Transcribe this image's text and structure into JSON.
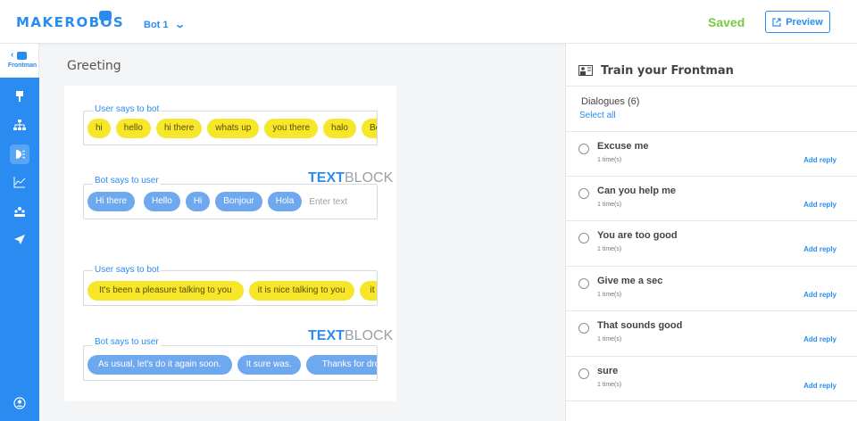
{
  "header": {
    "logo": "MAKEROBOS",
    "bot_name": "Bot 1",
    "saved": "Saved",
    "preview": "Preview"
  },
  "sidebar": {
    "frontman_label": "Frontman",
    "items": [
      {
        "name": "brush-icon"
      },
      {
        "name": "sitemap-icon"
      },
      {
        "name": "intent-icon",
        "active": true
      },
      {
        "name": "analytics-icon"
      },
      {
        "name": "users-icon"
      },
      {
        "name": "send-icon"
      },
      {
        "name": "account-icon"
      }
    ]
  },
  "main": {
    "title": "Greeting",
    "blocks": [
      {
        "user_label": "User says to bot",
        "user_says": [
          "hi",
          "hello",
          "hi there",
          "whats up",
          "you there",
          "halo",
          "Bonjour"
        ],
        "bot_label": "Bot says to user",
        "tab_text": "TEXT",
        "tab_block": "BLOCK",
        "bot_says": [
          "Hi there",
          "Hello",
          "Hi",
          "Bonjour",
          "Hola"
        ],
        "placeholder": "Enter text"
      },
      {
        "user_label": "User says to bot",
        "user_says": [
          "It's been a pleasure talking to you",
          "it is nice talking to you",
          "it has"
        ],
        "bot_label": "Bot says to user",
        "tab_text": "TEXT",
        "tab_block": "BLOCK",
        "bot_says": [
          "As usual, let's do it again soon.",
          "It sure was.",
          "Thanks for dropping"
        ]
      }
    ]
  },
  "right_panel": {
    "title": "Train your Frontman",
    "dialogues_label": "Dialogues (6)",
    "select_all": "Select all",
    "add_reply": "Add reply",
    "dialogues": [
      {
        "title": "Excuse me",
        "times": "1 time(s)"
      },
      {
        "title": "Can you help me",
        "times": "1 time(s)"
      },
      {
        "title": "You are too good",
        "times": "1 time(s)"
      },
      {
        "title": "Give me a sec",
        "times": "1 time(s)"
      },
      {
        "title": "That sounds good",
        "times": "1 time(s)"
      },
      {
        "title": "sure",
        "times": "1 time(s)"
      }
    ]
  },
  "colors": {
    "brand": "#2a8cf0",
    "saved": "#7ac943",
    "user_chip": "#f6e72b",
    "bot_chip": "#6ea9ef"
  }
}
